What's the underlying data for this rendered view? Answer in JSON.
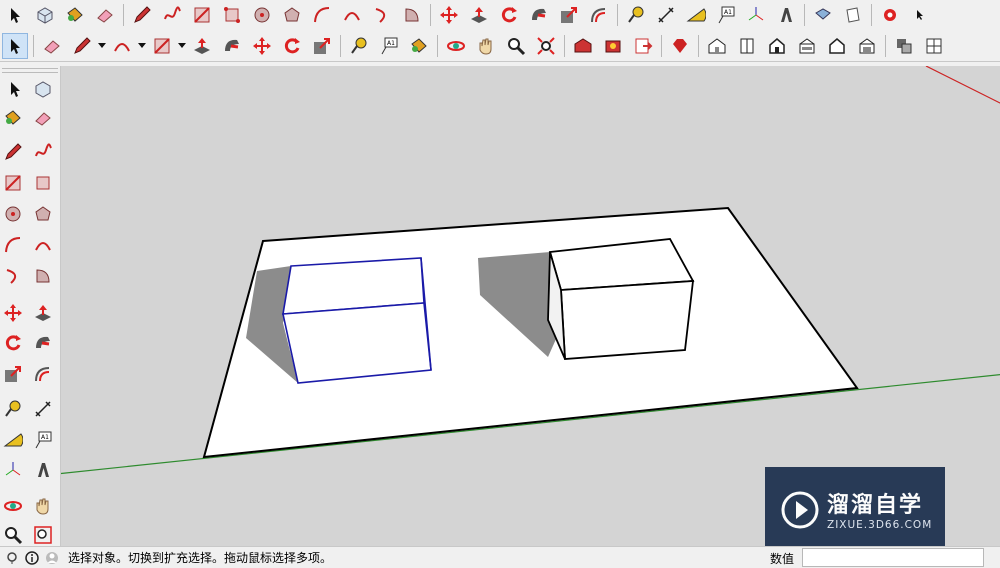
{
  "statusbar": {
    "message": "选择对象。切换到扩充选择。拖动鼠标选择多项。",
    "measurements_label": "数值",
    "measurements_value": ""
  },
  "watermark": {
    "title": "溜溜自学",
    "url": "ZIXUE.3D66.COM"
  },
  "toolbar_row1": [
    "select",
    "make-component",
    "paint-bucket",
    "eraser",
    "pencil",
    "freehand",
    "rectangle",
    "rotated-rectangle",
    "circle",
    "polygon",
    "arc",
    "arc-2pt",
    "arc-3pt",
    "pie",
    "move",
    "push-pull",
    "rotate",
    "follow-me",
    "scale",
    "offset",
    "tape-measure",
    "dimension",
    "protractor",
    "text",
    "axes",
    "3d-text",
    "position-camera",
    "look-around",
    "section-plane"
  ],
  "toolbar_row2": [
    "select",
    "eraser",
    "pencil",
    "arc",
    "rectangle",
    "push-pull",
    "follow-me",
    "move",
    "rotate",
    "scale",
    "tape-measure",
    "text",
    "paint-bucket",
    "orbit",
    "pan",
    "zoom",
    "zoom-extents",
    "3d-warehouse",
    "extension-warehouse",
    "send-to-layout",
    "ruby-console",
    "iso",
    "top",
    "front",
    "right",
    "back",
    "left",
    "components",
    "styles"
  ],
  "left_toolbar": [
    "select",
    "make-component",
    "paint-bucket",
    "eraser",
    "pencil",
    "freehand",
    "rectangle",
    "rotated-rectangle",
    "circle",
    "polygon",
    "arc",
    "arc-2pt",
    "arc-3pt",
    "pie",
    "move",
    "push-pull",
    "rotate",
    "follow-me",
    "scale",
    "offset",
    "tape-measure",
    "dimension",
    "protractor",
    "text",
    "axes",
    "3d-text",
    "orbit",
    "pan",
    "zoom",
    "zoom-window"
  ],
  "colors": {
    "background": "#d4d4d4",
    "selection_blue": "#1a1aa8",
    "green_axis": "#2e8b2e",
    "red_axis": "#cc2222"
  }
}
